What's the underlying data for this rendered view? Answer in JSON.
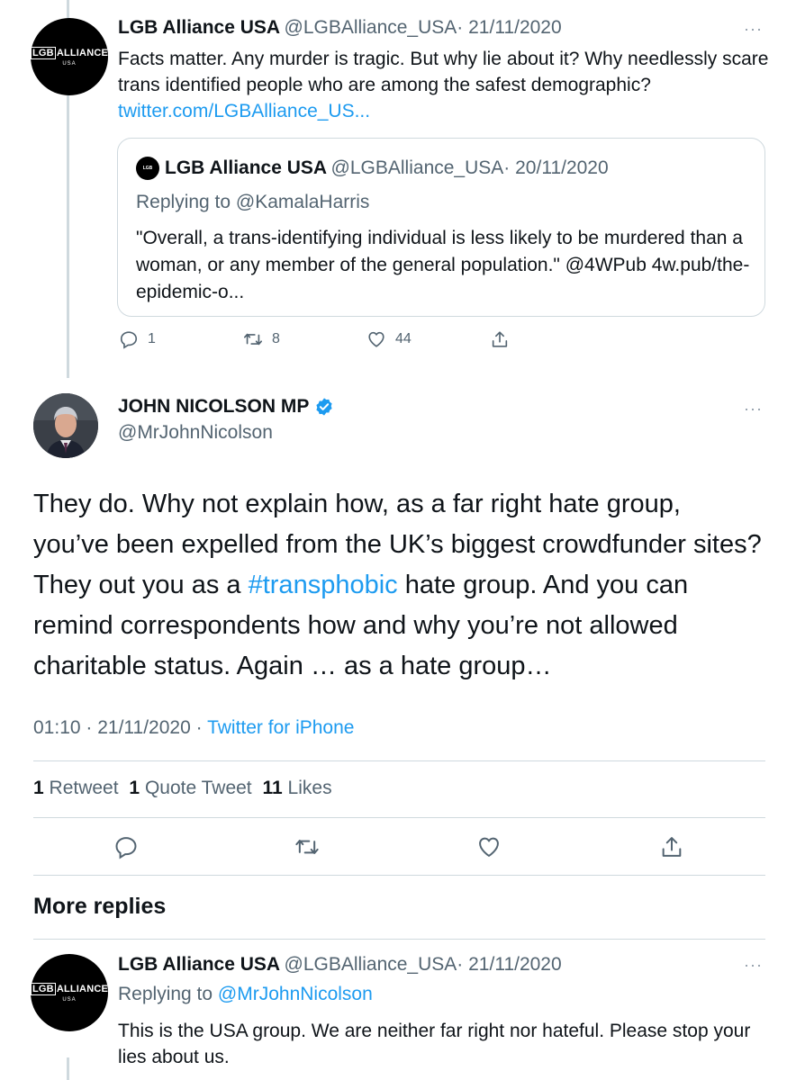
{
  "tweet1": {
    "name": "LGB Alliance USA",
    "handle": "@LGBAlliance_USA",
    "date": "· 21/11/2020",
    "text": "Facts matter. Any murder is tragic. But why lie about it? Why needlessly scare trans identified people who are among the safest demographic?",
    "link": "twitter.com/LGBAlliance_US...",
    "logo": {
      "box": "LGB",
      "rest": "ALLIANCE",
      "sub": "USA"
    },
    "quote": {
      "name": "LGB Alliance USA",
      "handle": "@LGBAlliance_USA",
      "date": "· 20/11/2020",
      "replying_prefix": "Replying to ",
      "replying_to": "@KamalaHarris",
      "text": "\"Overall, a trans-identifying individual is less likely to be murdered than a woman, or any member of the general population.\" @4WPub 4w.pub/the-epidemic-o..."
    },
    "actions": {
      "replies": "1",
      "retweets": "8",
      "likes": "44"
    }
  },
  "main_tweet": {
    "name": "JOHN NICOLSON MP",
    "handle": "@MrJohnNicolson",
    "text_before": "They do. Why not explain how, as a far right hate group, you’ve been expelled from the UK’s biggest crowdfunder sites? They out you as a ",
    "hashtag": "#transphobic",
    "text_after": " hate group. And you can remind correspondents how and why you’re not allowed charitable status. Again … as a hate group…",
    "time": "01:10 · 21/11/2020 ·",
    "source": "Twitter for iPhone",
    "stats": {
      "retweets_num": "1",
      "retweets_label": "Retweet",
      "quotes_num": "1",
      "quotes_label": "Quote Tweet",
      "likes_num": "11",
      "likes_label": "Likes"
    }
  },
  "more_replies_heading": "More replies",
  "reply": {
    "name": "LGB Alliance USA",
    "handle": "@LGBAlliance_USA",
    "date": "· 21/11/2020",
    "replying_prefix": "Replying to ",
    "replying_to": "@MrJohnNicolson",
    "text": "This is the USA group. We are neither far right nor hateful. Please stop your lies about us."
  },
  "more_glyph": "···",
  "colors": {
    "link": "#1d9bf0",
    "meta": "#536471",
    "verified": "#1d9bf0",
    "border": "#cfd9de"
  }
}
